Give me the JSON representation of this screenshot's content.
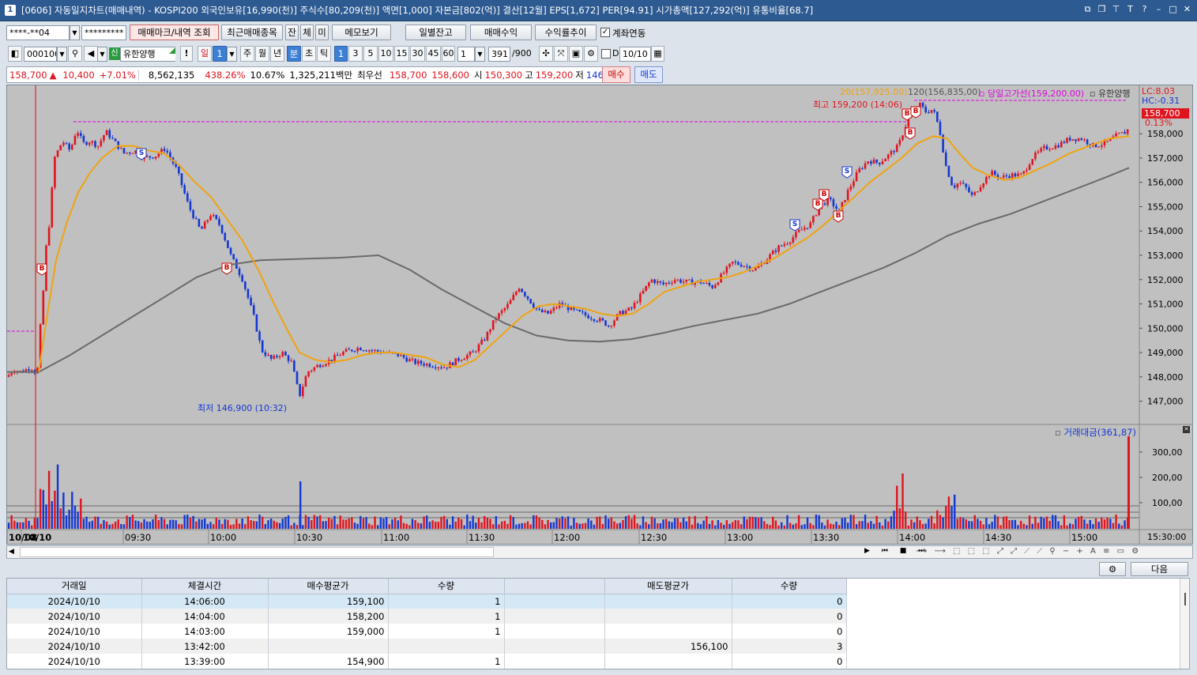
{
  "window": {
    "title": "[0606] 자동일지차트(매매내역) - KOSPI200 외국인보유[16,990(천)] 주식수[80,209(천)] 액면[1,000] 자본금[802(억)] 결산[12월] EPS[1,672] PER[94.91] 시가총액[127,292(억)] 유통비율[68.7]",
    "icon": "1"
  },
  "toolbar1": {
    "account": "****-**04",
    "password": "*********",
    "btn_markers": "매매마크/내역 조회",
    "btn_recent": "최근매매종목",
    "btn_jan": "잔",
    "btn_che": "체",
    "btn_mi": "미",
    "btn_memo": "메모보기",
    "btn_daily": "일별잔고",
    "btn_profit": "매매수익",
    "btn_trend": "수익률추이",
    "chk_link": "계좌연동"
  },
  "toolbar2": {
    "code": "000100",
    "stock_badge": "신",
    "stock_name": "유한양행",
    "excl": "!",
    "period_day": "일",
    "period_num": "1",
    "week": "주",
    "month": "월",
    "year": "년",
    "minute": "분",
    "cho": "초",
    "tick": "틱",
    "intervals": [
      "1",
      "3",
      "5",
      "10",
      "15",
      "30",
      "45",
      "60"
    ],
    "custom_interval": "1",
    "count": "391",
    "max": "/900",
    "d_label": "D",
    "date": "10/10"
  },
  "quote": {
    "price": "158,700",
    "arrow": "▲",
    "change": "10,400",
    "pct": "+7.01%",
    "volume": "8,562,135",
    "vol_ratio": "438.26%",
    "turnover": "10.67%",
    "amount": "1,325,211백만",
    "best_label": "최우선",
    "bid1": "158,700",
    "ask1": "158,600",
    "open_label": "시",
    "open": "150,300",
    "high_label": "고",
    "high": "159,200",
    "low_label": "저",
    "low": "146,900",
    "buy": "매수",
    "sell": "매도"
  },
  "chart_data": {
    "type": "candlestick",
    "x_ticks": [
      "10/08",
      "10/10",
      "09:30",
      "10:00",
      "10:30",
      "11:00",
      "11:30",
      "12:00",
      "12:30",
      "13:00",
      "13:30",
      "14:00",
      "14:30",
      "15:00"
    ],
    "y_ticks": [
      "158,000",
      "157,000",
      "156,000",
      "155,000",
      "154,000",
      "153,000",
      "152,000",
      "151,000",
      "150,000",
      "149,000",
      "148,000",
      "147,000"
    ],
    "ylim": [
      146400,
      159600
    ],
    "legend": {
      "ma20": "20(157,925.00)",
      "ma120": "120(156,835,00)",
      "day_high": "당일고가선(159,200.00)",
      "name": "유한양행",
      "lc": "LC:8.03",
      "hc": "HC:-0.31",
      "cur_price": "158,700",
      "cur_pct": "0.13%"
    },
    "annotations": {
      "high": "최고 159,200 (14:06)",
      "low": "최저 146,900 (10:32)"
    },
    "volume_legend": "거래대금(361,87)",
    "volume_ticks": [
      "300,00",
      "200,00",
      "100,00"
    ],
    "time_label": "15:30:00",
    "path": [
      [
        0,
        148000
      ],
      [
        8,
        148300
      ],
      [
        18,
        148200
      ],
      [
        30,
        148400
      ],
      [
        38,
        148100
      ],
      [
        42,
        150000
      ],
      [
        45,
        151000
      ],
      [
        48,
        153000
      ],
      [
        53,
        154200
      ],
      [
        60,
        157000
      ],
      [
        70,
        157700
      ],
      [
        80,
        157300
      ],
      [
        88,
        158200
      ],
      [
        96,
        157600
      ],
      [
        105,
        157700
      ],
      [
        115,
        157500
      ],
      [
        125,
        158100
      ],
      [
        135,
        157700
      ],
      [
        148,
        157200
      ],
      [
        162,
        157300
      ],
      [
        172,
        157000
      ],
      [
        188,
        157100
      ],
      [
        200,
        157400
      ],
      [
        215,
        156500
      ],
      [
        230,
        155000
      ],
      [
        245,
        154000
      ],
      [
        258,
        154700
      ],
      [
        270,
        154200
      ],
      [
        283,
        153000
      ],
      [
        298,
        152000
      ],
      [
        312,
        150500
      ],
      [
        322,
        149100
      ],
      [
        335,
        148700
      ],
      [
        348,
        149000
      ],
      [
        360,
        148600
      ],
      [
        370,
        147200
      ],
      [
        380,
        148200
      ],
      [
        395,
        148500
      ],
      [
        410,
        148700
      ],
      [
        425,
        149000
      ],
      [
        445,
        149200
      ],
      [
        460,
        149100
      ],
      [
        478,
        149000
      ],
      [
        495,
        148900
      ],
      [
        515,
        148600
      ],
      [
        535,
        148500
      ],
      [
        555,
        148400
      ],
      [
        570,
        148700
      ],
      [
        590,
        149000
      ],
      [
        605,
        149600
      ],
      [
        618,
        150400
      ],
      [
        635,
        151000
      ],
      [
        648,
        151700
      ],
      [
        660,
        151200
      ],
      [
        672,
        150700
      ],
      [
        685,
        150600
      ],
      [
        700,
        151000
      ],
      [
        718,
        150700
      ],
      [
        735,
        150500
      ],
      [
        752,
        150300
      ],
      [
        762,
        150100
      ],
      [
        775,
        150600
      ],
      [
        790,
        150800
      ],
      [
        805,
        151500
      ],
      [
        815,
        152000
      ],
      [
        830,
        151800
      ],
      [
        845,
        152000
      ],
      [
        860,
        151900
      ],
      [
        878,
        151900
      ],
      [
        893,
        151700
      ],
      [
        905,
        152200
      ],
      [
        918,
        152700
      ],
      [
        932,
        152600
      ],
      [
        946,
        152400
      ],
      [
        960,
        152800
      ],
      [
        975,
        153300
      ],
      [
        990,
        153600
      ],
      [
        1003,
        154000
      ],
      [
        1017,
        154300
      ],
      [
        1028,
        155000
      ],
      [
        1040,
        155300
      ],
      [
        1053,
        154800
      ],
      [
        1065,
        155700
      ],
      [
        1078,
        156500
      ],
      [
        1090,
        156900
      ],
      [
        1103,
        156800
      ],
      [
        1115,
        157100
      ],
      [
        1128,
        157500
      ],
      [
        1140,
        158600
      ],
      [
        1147,
        158900
      ],
      [
        1155,
        159200
      ],
      [
        1163,
        158900
      ],
      [
        1172,
        159000
      ],
      [
        1180,
        158200
      ],
      [
        1188,
        156700
      ],
      [
        1197,
        155800
      ],
      [
        1205,
        156000
      ],
      [
        1213,
        155800
      ],
      [
        1222,
        155400
      ],
      [
        1232,
        155900
      ],
      [
        1245,
        156400
      ],
      [
        1258,
        156200
      ],
      [
        1270,
        156300
      ],
      [
        1285,
        156300
      ],
      [
        1297,
        157000
      ],
      [
        1312,
        157400
      ],
      [
        1328,
        157500
      ],
      [
        1345,
        157800
      ],
      [
        1360,
        157800
      ],
      [
        1375,
        157500
      ],
      [
        1390,
        157600
      ],
      [
        1403,
        157900
      ],
      [
        1418,
        158100
      ],
      [
        1420,
        158700
      ]
    ],
    "ma20_path": [
      [
        40,
        148200
      ],
      [
        52,
        150800
      ],
      [
        62,
        152800
      ],
      [
        75,
        154300
      ],
      [
        90,
        155600
      ],
      [
        105,
        156400
      ],
      [
        120,
        157000
      ],
      [
        140,
        157500
      ],
      [
        160,
        157500
      ],
      [
        180,
        157300
      ],
      [
        198,
        157200
      ],
      [
        218,
        156700
      ],
      [
        238,
        156000
      ],
      [
        258,
        155400
      ],
      [
        278,
        154500
      ],
      [
        298,
        153600
      ],
      [
        318,
        152400
      ],
      [
        338,
        151000
      ],
      [
        355,
        149900
      ],
      [
        370,
        149000
      ],
      [
        390,
        148700
      ],
      [
        410,
        148600
      ],
      [
        430,
        148700
      ],
      [
        450,
        148900
      ],
      [
        470,
        149000
      ],
      [
        490,
        149000
      ],
      [
        510,
        148900
      ],
      [
        530,
        148800
      ],
      [
        552,
        148500
      ],
      [
        572,
        148400
      ],
      [
        592,
        148700
      ],
      [
        612,
        149300
      ],
      [
        632,
        149900
      ],
      [
        652,
        150500
      ],
      [
        672,
        150900
      ],
      [
        692,
        151000
      ],
      [
        712,
        150900
      ],
      [
        732,
        150800
      ],
      [
        752,
        150600
      ],
      [
        772,
        150500
      ],
      [
        792,
        150600
      ],
      [
        812,
        151000
      ],
      [
        832,
        151500
      ],
      [
        852,
        151700
      ],
      [
        872,
        151900
      ],
      [
        892,
        152000
      ],
      [
        912,
        152100
      ],
      [
        932,
        152300
      ],
      [
        952,
        152600
      ],
      [
        972,
        152900
      ],
      [
        992,
        153300
      ],
      [
        1012,
        153700
      ],
      [
        1032,
        154200
      ],
      [
        1052,
        154800
      ],
      [
        1072,
        155400
      ],
      [
        1092,
        156000
      ],
      [
        1112,
        156500
      ],
      [
        1132,
        157000
      ],
      [
        1152,
        157600
      ],
      [
        1172,
        157900
      ],
      [
        1190,
        157800
      ],
      [
        1205,
        157200
      ],
      [
        1222,
        156600
      ],
      [
        1242,
        156300
      ],
      [
        1262,
        156100
      ],
      [
        1282,
        156200
      ],
      [
        1302,
        156500
      ],
      [
        1322,
        156800
      ],
      [
        1345,
        157200
      ],
      [
        1370,
        157500
      ],
      [
        1395,
        157800
      ],
      [
        1420,
        157900
      ]
    ],
    "ma120_path": [
      [
        0,
        148200
      ],
      [
        40,
        148200
      ],
      [
        80,
        148900
      ],
      [
        120,
        149700
      ],
      [
        160,
        150500
      ],
      [
        200,
        151300
      ],
      [
        240,
        152100
      ],
      [
        280,
        152600
      ],
      [
        320,
        152800
      ],
      [
        370,
        152850
      ],
      [
        420,
        152900
      ],
      [
        470,
        153000
      ],
      [
        510,
        152400
      ],
      [
        550,
        151600
      ],
      [
        590,
        150900
      ],
      [
        630,
        150200
      ],
      [
        670,
        149700
      ],
      [
        710,
        149500
      ],
      [
        750,
        149450
      ],
      [
        790,
        149550
      ],
      [
        830,
        149800
      ],
      [
        870,
        150100
      ],
      [
        910,
        150350
      ],
      [
        950,
        150600
      ],
      [
        990,
        151000
      ],
      [
        1030,
        151500
      ],
      [
        1070,
        152000
      ],
      [
        1110,
        152500
      ],
      [
        1150,
        153100
      ],
      [
        1190,
        153800
      ],
      [
        1230,
        154300
      ],
      [
        1270,
        154700
      ],
      [
        1310,
        155200
      ],
      [
        1350,
        155700
      ],
      [
        1390,
        156200
      ],
      [
        1420,
        156600
      ]
    ]
  },
  "chart_icons": [
    "b-marker-icon",
    "s-marker-icon"
  ],
  "nav": {
    "next": "다음"
  },
  "trades": {
    "columns": [
      "거래일",
      "체결시간",
      "매수평균가",
      "수량",
      "",
      "매도평균가",
      "수량"
    ],
    "rows": [
      [
        "2024/10/10",
        "14:06:00",
        "159,100",
        "1",
        "",
        "",
        "0"
      ],
      [
        "2024/10/10",
        "14:04:00",
        "158,200",
        "1",
        "",
        "",
        "0"
      ],
      [
        "2024/10/10",
        "14:03:00",
        "159,000",
        "1",
        "",
        "",
        "0"
      ],
      [
        "2024/10/10",
        "13:42:00",
        "",
        "",
        "",
        "156,100",
        "3"
      ],
      [
        "2024/10/10",
        "13:39:00",
        "154,900",
        "1",
        "",
        "",
        "0"
      ]
    ]
  },
  "colors": {
    "up": "#e0141e",
    "down": "#1437d2",
    "ma20": "#f0a30f",
    "ma120": "#6a6a6a",
    "chart_bg": "#c0c0c0",
    "day_high": "#e000e0"
  }
}
